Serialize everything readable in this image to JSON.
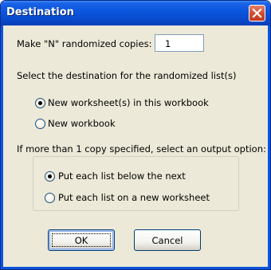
{
  "dialog": {
    "title": "Destination",
    "close_icon": "close-icon"
  },
  "copies": {
    "label": "Make \"N\" randomized copies:",
    "value": "1"
  },
  "destination": {
    "prompt": "Select the destination for the randomized list(s)",
    "options": [
      {
        "label": "New worksheet(s) in this workbook",
        "selected": true
      },
      {
        "label": "New workbook",
        "selected": false
      }
    ]
  },
  "output": {
    "prompt": "If more than 1 copy specified, select an output option:",
    "options": [
      {
        "label": "Put each list below the next",
        "selected": true
      },
      {
        "label": "Put each list on a new worksheet",
        "selected": false
      }
    ]
  },
  "buttons": {
    "ok": "OK",
    "cancel": "Cancel"
  }
}
